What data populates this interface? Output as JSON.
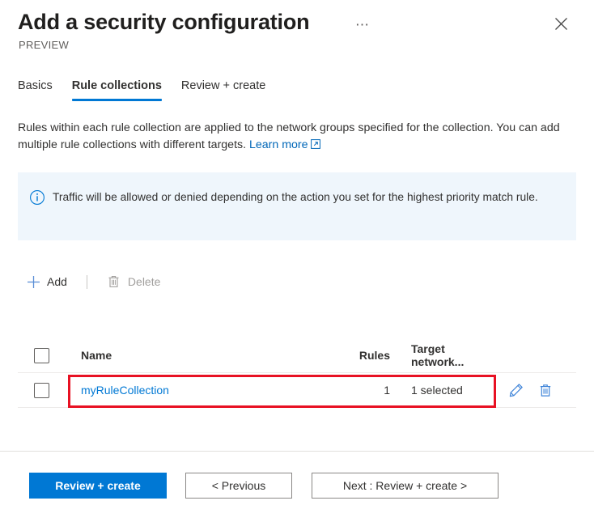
{
  "header": {
    "title": "Add a security configuration",
    "subtitle": "PREVIEW",
    "more_label": "⋯",
    "close_label": "Close"
  },
  "tabs": [
    {
      "label": "Basics",
      "active": false
    },
    {
      "label": "Rule collections",
      "active": true
    },
    {
      "label": "Review + create",
      "active": false
    }
  ],
  "description": {
    "line1": "Rules within each rule collection are applied to the network groups specified for the collection.",
    "line2": "You can add multiple rule collections with different targets.",
    "link_label": "Learn more"
  },
  "info_banner": {
    "icon": "info-circle-icon",
    "text": "Traffic will be allowed or denied depending on the action you set for the highest priority match rule.",
    "background_color": "#eff6fc",
    "icon_color": "#0078d4"
  },
  "command_bar": {
    "add_label": "Add",
    "add_icon": "plus-icon",
    "delete_label": "Delete",
    "delete_icon": "trash-icon",
    "delete_disabled": true
  },
  "table": {
    "columns": [
      "Name",
      "Rules",
      "Target network..."
    ],
    "rows": [
      {
        "name": "myRuleCollection",
        "rules": "1",
        "target_networks": "1 selected",
        "edit_icon": "pencil-icon",
        "delete_icon": "trash-icon"
      }
    ]
  },
  "annotation": {
    "highlight_color": "#e81123"
  },
  "footer": {
    "primary_label": "Review + create",
    "previous_label": "< Previous",
    "next_label": "Next : Review + create >"
  },
  "colors": {
    "accent": "#0078d4",
    "link": "#0067b8",
    "text": "#323130",
    "muted": "#605e5c",
    "disabled": "#a19f9d",
    "divider": "#e1dfdd"
  }
}
